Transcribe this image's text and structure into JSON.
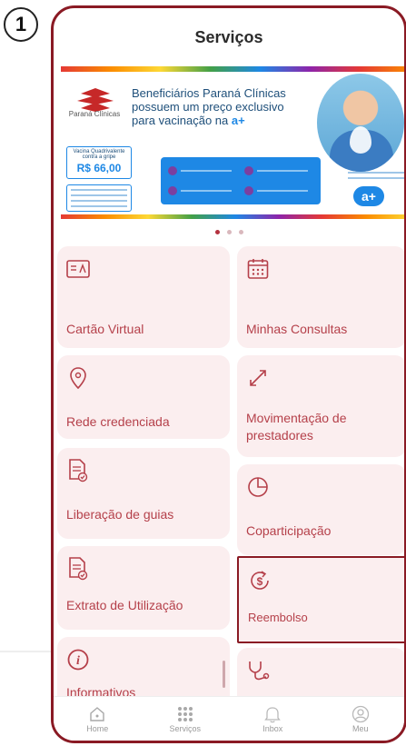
{
  "step_marker": "1",
  "header": {
    "title": "Serviços"
  },
  "banner": {
    "partner_name": "Paraná Clínicas",
    "headline_line1": "Beneficiários Paraná Clínicas",
    "headline_line2": "possuem um preço exclusivo",
    "headline_line3": "para vacinação na",
    "headline_brand": "a+",
    "price_caption": "Vacina Quadrivalente contra a gripe",
    "price": "R$ 66,00",
    "aplus_badge": "a+"
  },
  "carousel": {
    "total": 3,
    "active": 0
  },
  "services_left": [
    {
      "label": "Cartão Virtual",
      "icon": "id-card-icon"
    },
    {
      "label": "Rede credenciada",
      "icon": "location-pin-icon"
    },
    {
      "label": "Liberação de guias",
      "icon": "document-check-icon"
    },
    {
      "label": "Extrato de Utilização",
      "icon": "document-check-icon"
    },
    {
      "label": "Informativos",
      "icon": "info-icon"
    }
  ],
  "services_right": [
    {
      "label": "Minhas Consultas",
      "icon": "calendar-icon"
    },
    {
      "label": "Movimentação de prestadores",
      "icon": "expand-arrows-icon"
    },
    {
      "label": "Coparticipação",
      "icon": "pie-chart-icon"
    },
    {
      "label": "Reembolso",
      "icon": "money-refund-icon"
    },
    {
      "label": "",
      "icon": "stethoscope-icon"
    }
  ],
  "bottom_nav": [
    {
      "label": "Home",
      "icon": "home-icon"
    },
    {
      "label": "Serviços",
      "icon": "grid-icon"
    },
    {
      "label": "Inbox",
      "icon": "bell-icon"
    },
    {
      "label": "Meu",
      "icon": "user-icon"
    }
  ],
  "colors": {
    "accent": "#b5404a",
    "frame": "#8a1a24",
    "tile_bg": "#fbeeef",
    "banner_blue": "#1e88e5"
  }
}
